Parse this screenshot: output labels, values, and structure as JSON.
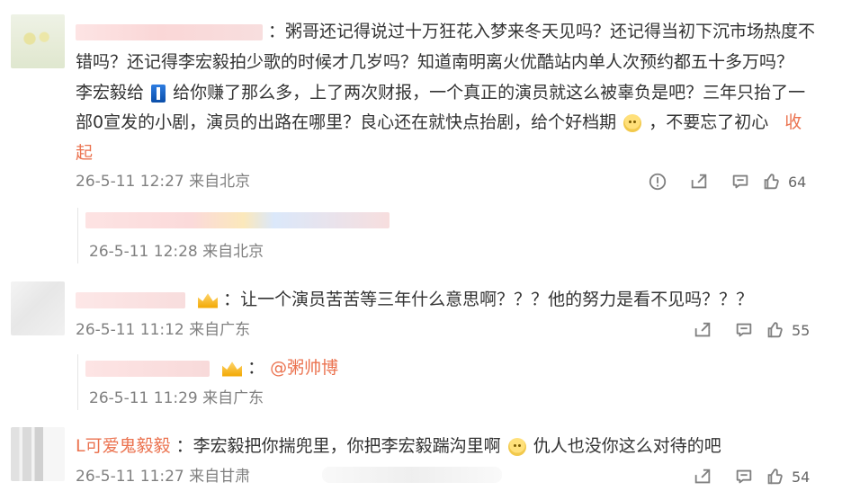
{
  "comments": [
    {
      "lines": [
        "：粥哥还记得说过十万狂花入梦来冬天见吗？还记得当初下沉市场热度不",
        "错吗？还记得李宏毅拍少歌的时候才几岁吗？知道南明离火优酷站内单人次预约都五十多万吗？",
        "李宏毅给",
        "给你赚了那么多，上了两次财报，一个真正的演员就这么被辜负是吧？三年只抬了一",
        "部0宣发的小剧，演员的出路在哪里？良心还在就快点抬剧，给个好档期",
        "，不要忘了初心",
        "收",
        "起"
      ],
      "timestamp": "26-5-11 12:27 来自北京",
      "like_count": "64",
      "reply": {
        "timestamp": "26-5-11 12:28 来自北京"
      }
    },
    {
      "text": "：让一个演员苦苦等三年什么意思啊？？？他的努力是看不见吗？？？",
      "timestamp": "26-5-11 11:12 来自广东",
      "like_count": "55",
      "reply": {
        "text_prefix": "：",
        "mention": "@粥帅博",
        "timestamp": "26-5-11 11:29 来自广东"
      }
    },
    {
      "username": "L可爱鬼毅毅",
      "text_part1": "：李宏毅把你揣兜里，你把李宏毅踹沟里啊",
      "text_part2": "仇人也没你这么对待的吧",
      "timestamp": "26-5-11 11:27 来自甘肃",
      "like_count": "54"
    }
  ],
  "icons": {
    "report": "report-icon",
    "share": "share-icon",
    "comment": "comment-icon",
    "like": "like-icon",
    "crown": "crown-icon",
    "emoji": "smile-emoji-icon",
    "rank": "rank-icon"
  },
  "colors": {
    "text": "#333333",
    "muted": "#808080",
    "accent": "#eb7350",
    "border": "#e5e5e5"
  }
}
